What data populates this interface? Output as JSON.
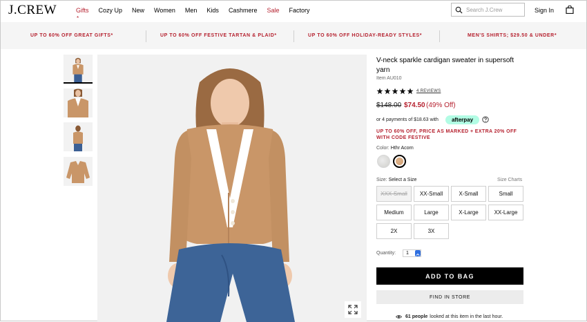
{
  "header": {
    "logo": "J.CREW",
    "nav": [
      {
        "label": "Gifts",
        "red": true
      },
      {
        "label": "Cozy Up",
        "red": false
      },
      {
        "label": "New",
        "red": false
      },
      {
        "label": "Women",
        "red": false
      },
      {
        "label": "Men",
        "red": false
      },
      {
        "label": "Kids",
        "red": false
      },
      {
        "label": "Cashmere",
        "red": false
      },
      {
        "label": "Sale",
        "red": true
      },
      {
        "label": "Factory",
        "red": false
      }
    ],
    "gift_marker": "*",
    "search_placeholder": "Search J.Crew",
    "sign_in": "Sign In"
  },
  "promos": [
    "UP TO 60% OFF GREAT GIFTS*",
    "UP TO 60% OFF FESTIVE TARTAN & PLAID*",
    "UP TO 60% OFF HOLIDAY-READY STYLES*",
    "MEN'S SHIRTS; $29.50 & UNDER*"
  ],
  "product": {
    "title": "V-neck sparkle cardigan sweater in supersoft yarn",
    "item_number": "Item AU010",
    "rating_stars": 5,
    "reviews_label": "4 REVIEWS",
    "original_price": "$148.00",
    "sale_price": "$74.50",
    "discount": "(49% Off)",
    "afterpay_text": "or 4 payments of $18.63 with",
    "afterpay_badge": "afterpay",
    "promo_note": "UP TO 60% OFF, PRICE AS MARKED + EXTRA 20% OFF WITH CODE FESTIVE",
    "color_label": "Color:",
    "color_value": "Hthr Acorn",
    "size_label": "Size:",
    "size_value": "Select a Size",
    "size_charts": "Size Charts",
    "sizes": [
      {
        "label": "XXX-Small",
        "available": false
      },
      {
        "label": "XX-Small",
        "available": true
      },
      {
        "label": "X-Small",
        "available": true
      },
      {
        "label": "Small",
        "available": true
      },
      {
        "label": "Medium",
        "available": true
      },
      {
        "label": "Large",
        "available": true
      },
      {
        "label": "X-Large",
        "available": true
      },
      {
        "label": "XX-Large",
        "available": true
      },
      {
        "label": "2X",
        "available": true
      },
      {
        "label": "3X",
        "available": true
      }
    ],
    "quantity_label": "Quantity:",
    "quantity_value": "1",
    "add_to_bag": "ADD TO BAG",
    "find_in_store": "FIND IN STORE",
    "viewers_count": "61 people",
    "viewers_text": "looked at this item in the last hour."
  },
  "colors": {
    "accent_red": "#b5202e",
    "afterpay_mint": "#b2fce4",
    "button_black": "#000000"
  }
}
